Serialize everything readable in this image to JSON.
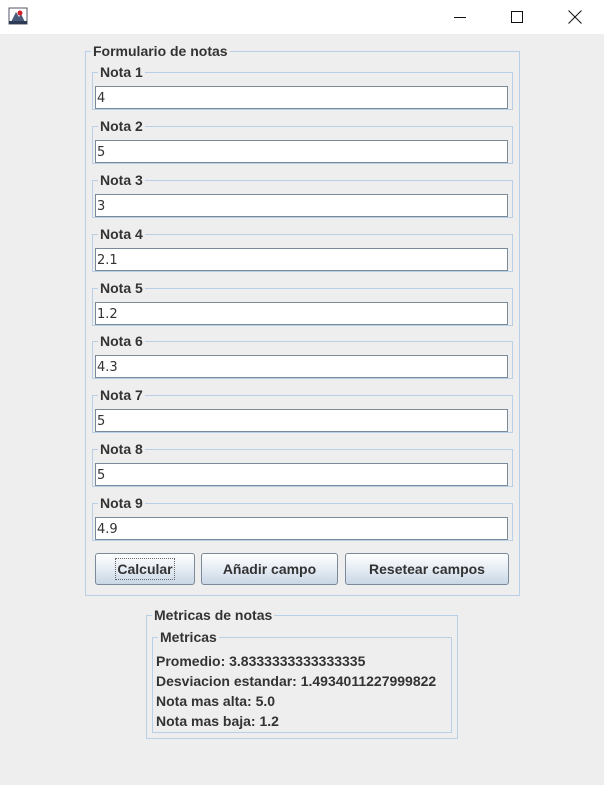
{
  "window": {
    "controls": {
      "minimize": "minimize-icon",
      "maximize": "maximize-icon",
      "close": "close-icon"
    }
  },
  "form": {
    "title": "Formulario de notas",
    "fields": [
      {
        "label": "Nota 1",
        "value": "4"
      },
      {
        "label": "Nota 2",
        "value": "5"
      },
      {
        "label": "Nota 3",
        "value": "3"
      },
      {
        "label": "Nota 4",
        "value": "2.1"
      },
      {
        "label": "Nota 5",
        "value": "1.2"
      },
      {
        "label": "Nota 6",
        "value": "4.3"
      },
      {
        "label": "Nota 7",
        "value": "5"
      },
      {
        "label": "Nota 8",
        "value": "5"
      },
      {
        "label": "Nota 9",
        "value": "4.9"
      }
    ],
    "buttons": {
      "calcular": "Calcular",
      "anadir": "Añadir campo",
      "resetear": "Resetear campos"
    }
  },
  "metrics": {
    "outer_title": "Metricas de notas",
    "inner_title": "Metricas",
    "promedio": "Promedio: 3.8333333333333335",
    "desviacion": "Desviacion estandar: 1.4934011227999822",
    "alta": "Nota mas alta: 5.0",
    "baja": "Nota mas baja: 1.2"
  }
}
